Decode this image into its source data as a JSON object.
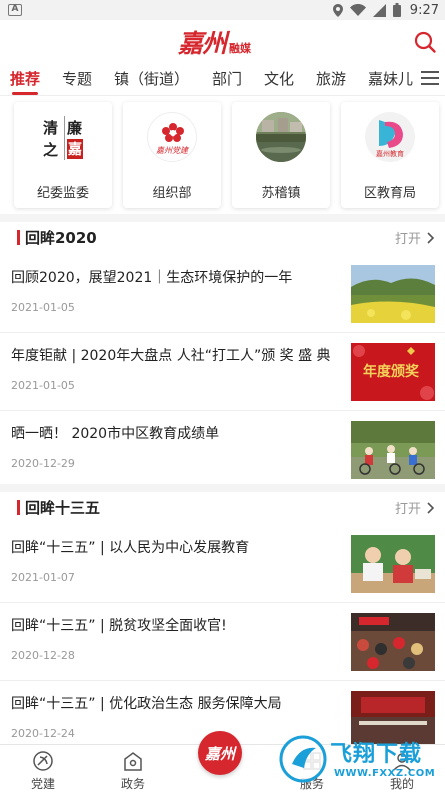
{
  "status_bar": {
    "time": "9:27",
    "left_icon": "a-notification-icon",
    "right_icons": [
      "location-icon",
      "wifi-icon",
      "signal-icon",
      "battery-icon"
    ]
  },
  "header": {
    "logo_main": "嘉州",
    "logo_sub": "融媒",
    "search_icon": "search-icon"
  },
  "tabs": [
    {
      "label": "推荐",
      "active": true
    },
    {
      "label": "专题"
    },
    {
      "label": "镇（街道）"
    },
    {
      "label": "部门"
    },
    {
      "label": "文化"
    },
    {
      "label": "旅游"
    },
    {
      "label": "嘉妹儿"
    }
  ],
  "channels": [
    {
      "label": "纪委监委",
      "icon_text": [
        "清",
        "廉",
        "之",
        "嘉"
      ]
    },
    {
      "label": "组织部",
      "icon_text": [
        "嘉州党建"
      ]
    },
    {
      "label": "苏稽镇",
      "icon_text": []
    },
    {
      "label": "区教育局",
      "icon_text": [
        "嘉州教育"
      ]
    }
  ],
  "sections": [
    {
      "title": "回眸2020",
      "more": "打开",
      "articles": [
        {
          "title": "回顾2020，展望2021｜生态环境保护的一年",
          "date": "2021-01-05"
        },
        {
          "title": "年度钜献 | 2020年大盘点 人社“打工人”颁 奖 盛 典",
          "date": "2021-01-05",
          "thumb_text": "年度颁奖"
        },
        {
          "title": "晒一晒！ 2020市中区教育成绩单",
          "date": "2020-12-29"
        }
      ]
    },
    {
      "title": "回眸十三五",
      "more": "打开",
      "articles": [
        {
          "title": "回眸“十三五” | 以人民为中心发展教育",
          "date": "2021-01-07"
        },
        {
          "title": "回眸“十三五” | 脱贫攻坚全面收官!",
          "date": "2020-12-28"
        },
        {
          "title": "回眸“十三五” | 优化政治生态 服务保障大局",
          "date": "2020-12-24"
        }
      ]
    }
  ],
  "bottom_nav": [
    {
      "label": "党建",
      "icon": "party-emblem-icon"
    },
    {
      "label": "政务",
      "icon": "government-icon"
    },
    {
      "label": "嘉州",
      "icon": "home-logo-icon"
    },
    {
      "label": "服务",
      "icon": "service-icon"
    },
    {
      "label": "我的",
      "icon": "profile-icon"
    }
  ],
  "watermark": {
    "text": "飞翔下载",
    "url": "WWW.FXXZ.COM"
  },
  "colors": {
    "accent": "#d5272d",
    "watermark": "#1a9fd8"
  }
}
